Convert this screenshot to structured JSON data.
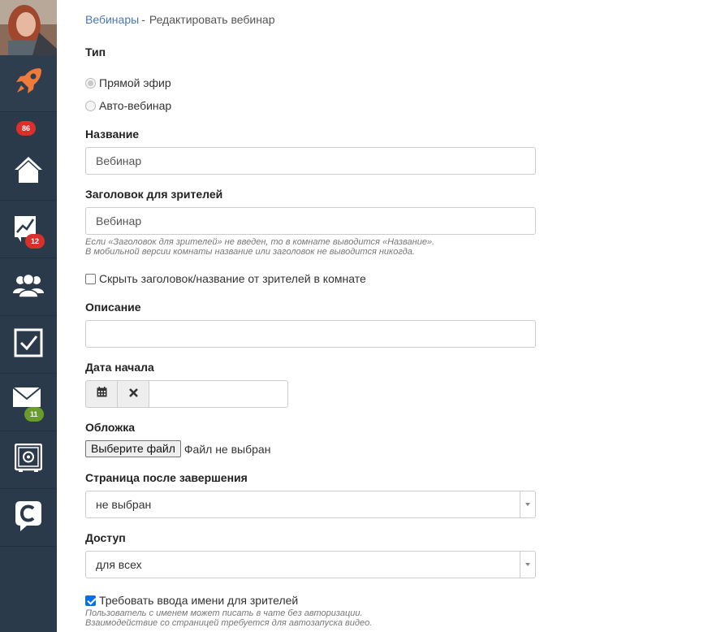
{
  "sidebar": {
    "badges": {
      "notifications": "86",
      "analytics": "12",
      "messages": "11"
    },
    "items": [
      {
        "icon": "rocket-icon",
        "color": "#f07a3a"
      },
      {
        "icon": "home-icon"
      },
      {
        "icon": "analytics-icon"
      },
      {
        "icon": "users-icon"
      },
      {
        "icon": "tasks-icon"
      },
      {
        "icon": "mail-icon"
      },
      {
        "icon": "safe-icon"
      },
      {
        "icon": "chat-c-icon"
      }
    ]
  },
  "breadcrumb": {
    "parent": "Вебинары",
    "separator": "-",
    "current": "Редактировать вебинар"
  },
  "form": {
    "type": {
      "label": "Тип",
      "options": [
        "Прямой эфир",
        "Авто-вебинар"
      ],
      "selected": "Прямой эфир"
    },
    "name": {
      "label": "Название",
      "value": "Вебинар"
    },
    "viewer_title": {
      "label": "Заголовок для зрителей",
      "value": "Вебинар",
      "help_line1": "Если «Заголовок для зрителей» не введен, то в комнате выводится «Название».",
      "help_line2": "В мобильной версии комнаты название или заголовок не выводится никогда."
    },
    "hide_title": {
      "label": "Скрыть заголовок/название от зрителей в комнате",
      "checked": false
    },
    "description": {
      "label": "Описание",
      "value": ""
    },
    "start_date": {
      "label": "Дата начала",
      "value": ""
    },
    "cover": {
      "label": "Обложка",
      "button": "Выберите файл",
      "status": "Файл не выбран"
    },
    "after_page": {
      "label": "Страница после завершения",
      "value": "не выбран"
    },
    "access": {
      "label": "Доступ",
      "value": "для всех"
    },
    "require_name": {
      "label": "Требовать ввода имени для зрителей",
      "checked": true,
      "help_line1": "Пользователь с именем может писать в чате без авторизации.",
      "help_line2": "Взаимодействие со страницей требуется для автозапуска видео."
    }
  },
  "colors": {
    "sidebar_bg": "#2b3a4a",
    "link": "#4a78b0",
    "badge_red": "#d9302c",
    "badge_green": "#6a9c2d",
    "checkbox_checked": "#0a6ee8"
  }
}
